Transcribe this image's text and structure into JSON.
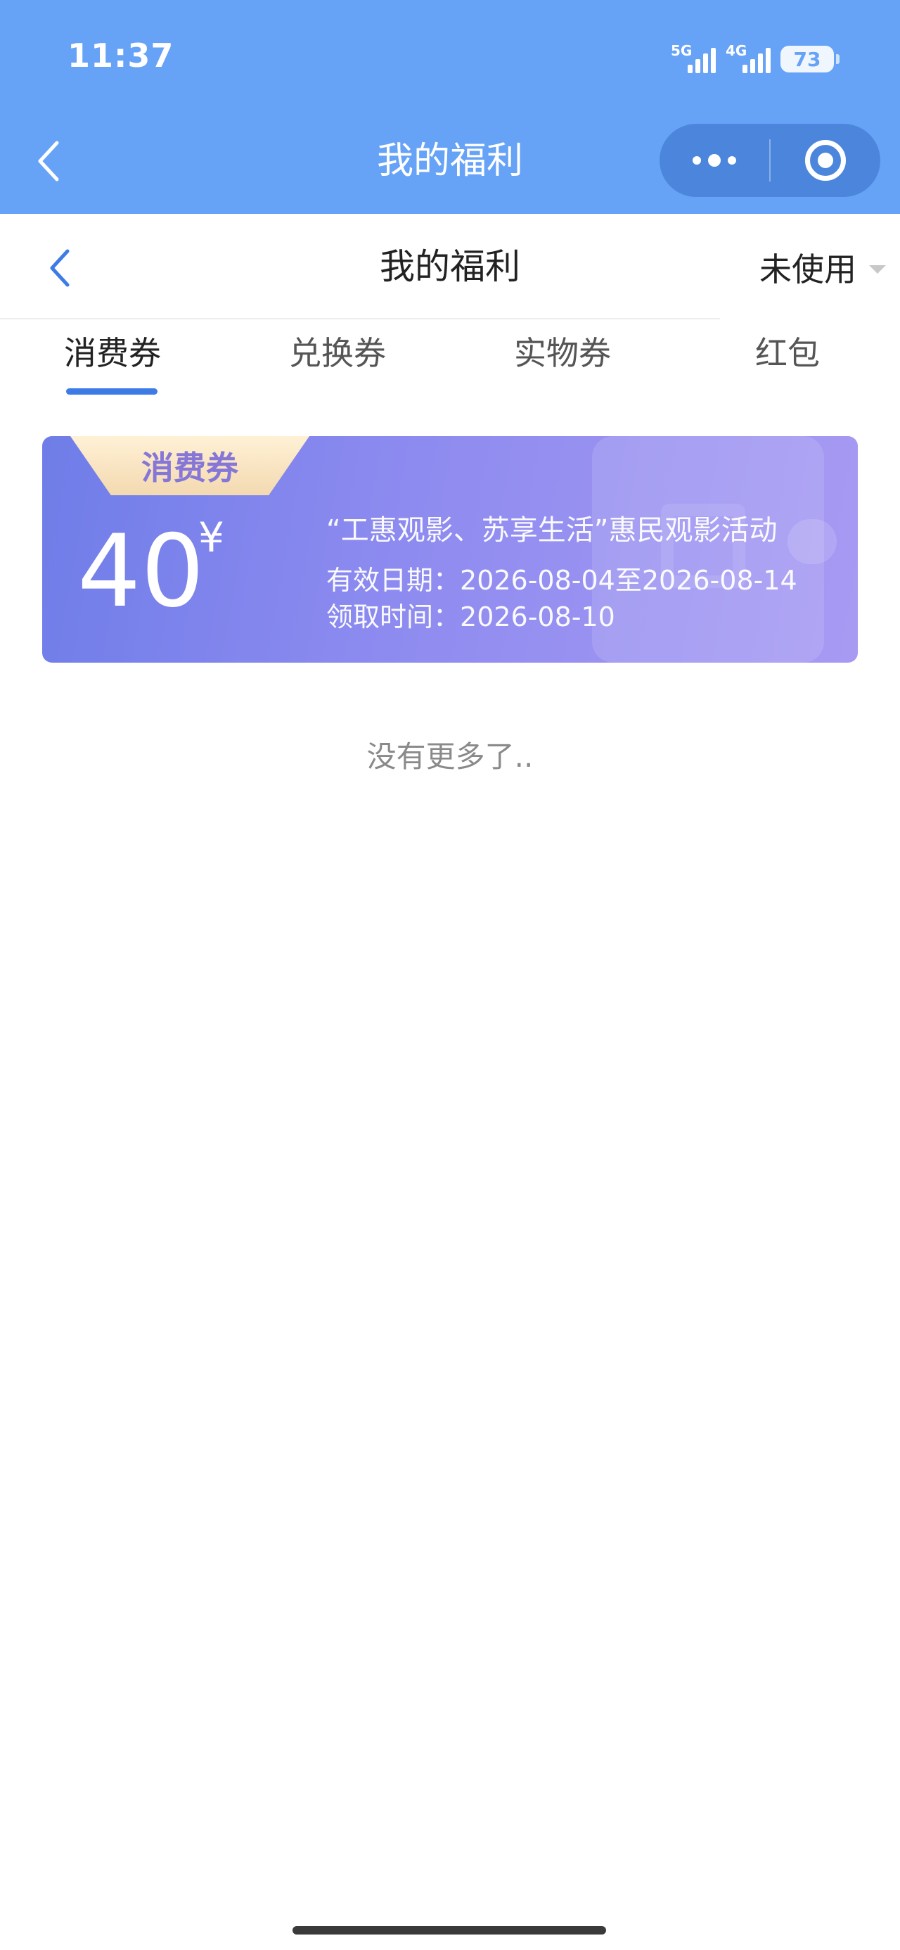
{
  "status_bar": {
    "time": "11:37",
    "network1": "5G",
    "network2": "4G",
    "battery": "73"
  },
  "miniapp_bar": {
    "title": "我的福利",
    "back_icon": "chevron-left-icon",
    "more_icon": "more-dots-icon",
    "close_icon": "target-circle-icon",
    "background": "#66a2f6"
  },
  "page_header": {
    "title": "我的福利",
    "back_icon": "chevron-left-icon",
    "filter_label": "未使用",
    "accent": "#3d7be7"
  },
  "tabs": [
    {
      "label": "消费券",
      "active": true
    },
    {
      "label": "兑换券",
      "active": false
    },
    {
      "label": "实物券",
      "active": false
    },
    {
      "label": "红包",
      "active": false
    }
  ],
  "coupons": [
    {
      "tag": "消费券",
      "amount": "40",
      "currency": "¥",
      "name": "“工惠观影、苏享生活”惠民观影活动",
      "valid_label": "有效日期：",
      "valid_range": "2026-08-04至2026-08-14",
      "received_label": "领取时间：",
      "received_date": "2026-08-10"
    }
  ],
  "list_end_text": "没有更多了.."
}
